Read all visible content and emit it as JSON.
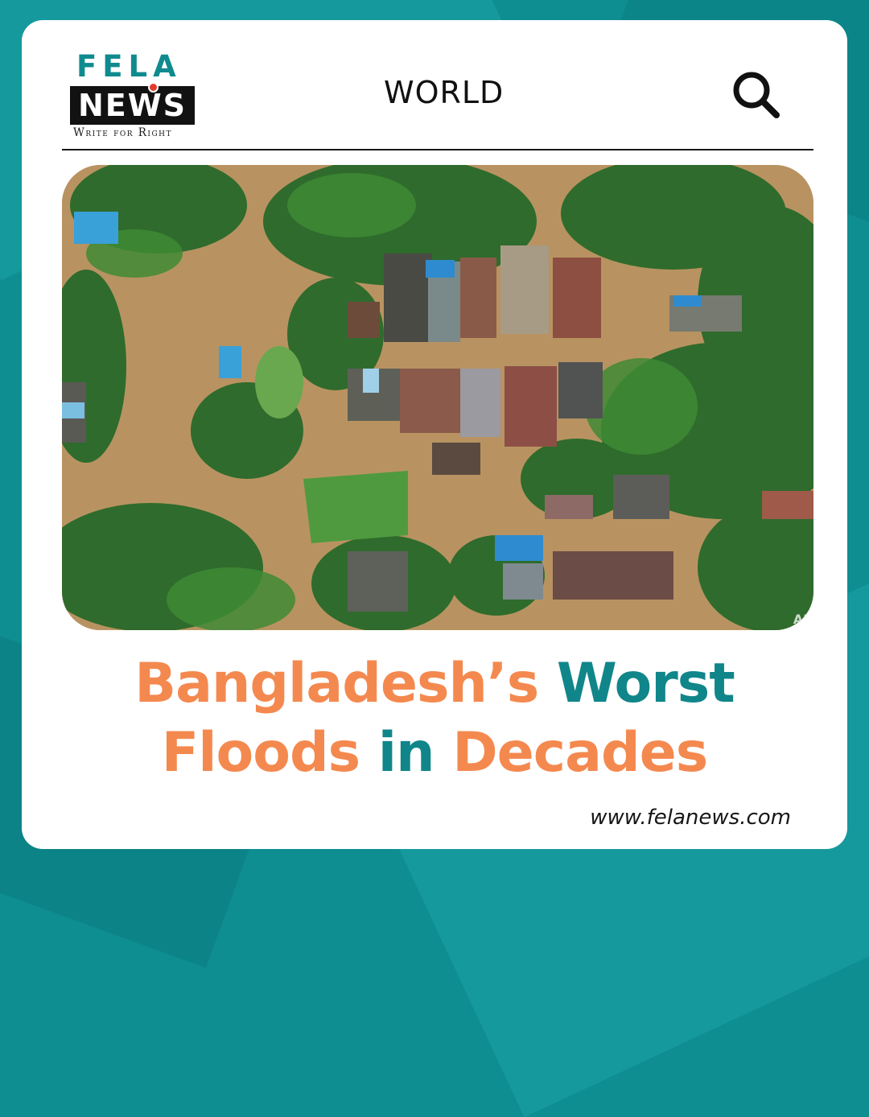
{
  "brand": {
    "logo_top": "FELA",
    "logo_bottom": "NEWS",
    "tagline": "Write for Right",
    "url": "www.felanews.com"
  },
  "header": {
    "section": "WORLD",
    "search_icon": "search-icon"
  },
  "photo": {
    "credit": "AF"
  },
  "headline": {
    "part1": "Bangladesh’s",
    "part2": "Worst",
    "part3": "Floods",
    "part4": "in",
    "part5": "Decades"
  },
  "colors": {
    "brand_teal": "#10868a",
    "accent_orange": "#f4894f",
    "background": "#0f8e92"
  }
}
